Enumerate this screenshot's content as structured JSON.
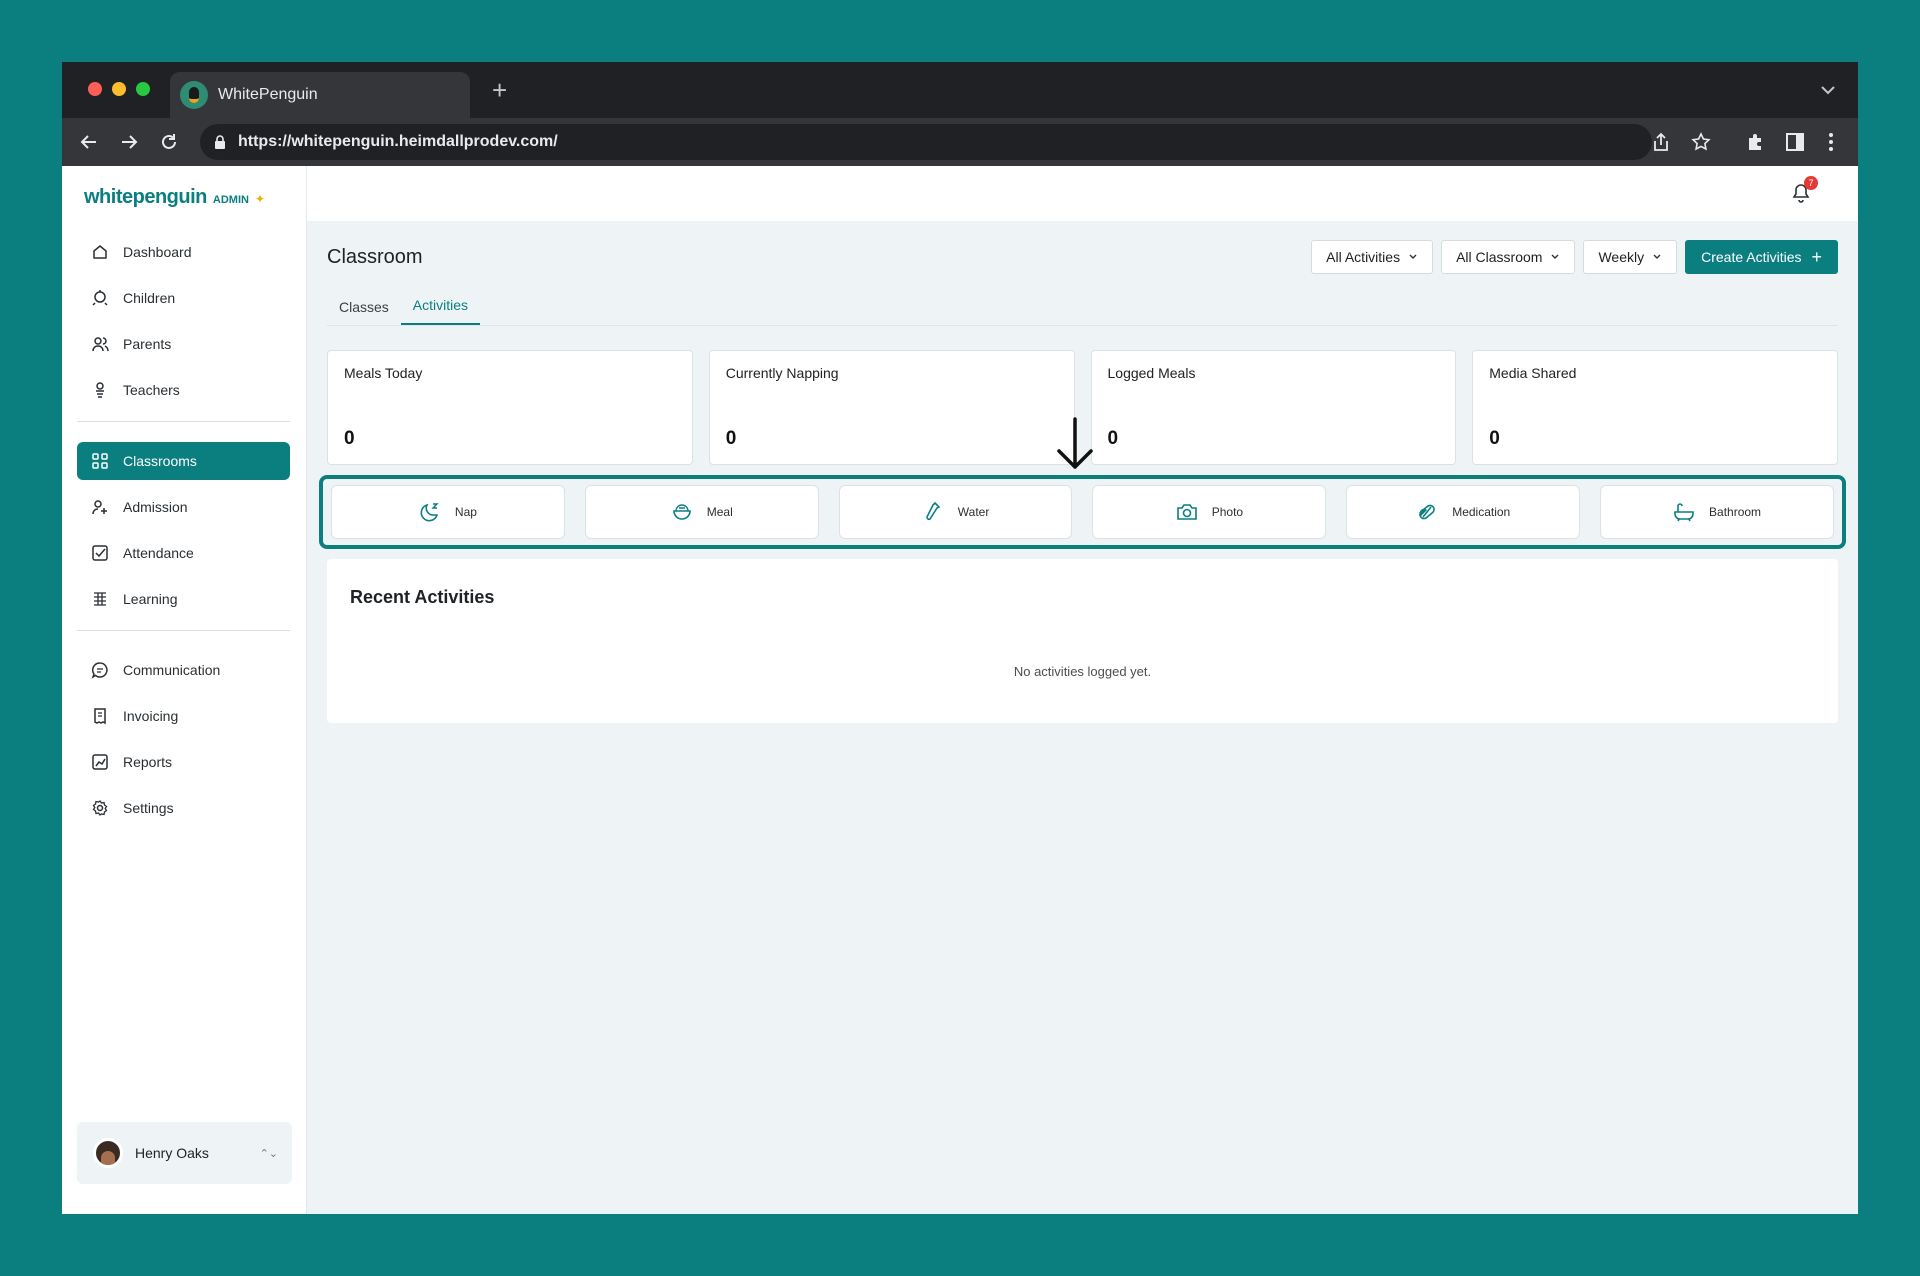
{
  "browser": {
    "tab_title": "WhitePenguin",
    "new_tab": "+",
    "url": "https://whitepenguin.heimdallprodev.com/"
  },
  "brand": {
    "logo": "whitepenguin",
    "role": "ADMIN",
    "badge": "✦"
  },
  "sidebar": {
    "items": [
      {
        "label": "Dashboard",
        "icon": "home-icon"
      },
      {
        "label": "Children",
        "icon": "child-icon"
      },
      {
        "label": "Parents",
        "icon": "parents-icon"
      },
      {
        "label": "Teachers",
        "icon": "teacher-icon"
      }
    ],
    "items2": [
      {
        "label": "Classrooms",
        "icon": "grid-icon",
        "active": true
      },
      {
        "label": "Admission",
        "icon": "admission-icon"
      },
      {
        "label": "Attendance",
        "icon": "check-icon"
      },
      {
        "label": "Learning",
        "icon": "learning-icon"
      }
    ],
    "items3": [
      {
        "label": "Communication",
        "icon": "chat-icon"
      },
      {
        "label": "Invoicing",
        "icon": "invoice-icon"
      },
      {
        "label": "Reports",
        "icon": "reports-icon"
      },
      {
        "label": "Settings",
        "icon": "gear-icon"
      }
    ]
  },
  "user": {
    "name": "Henry Oaks",
    "caret": "⌃⌄"
  },
  "notifications": {
    "count": "7"
  },
  "page": {
    "title": "Classroom",
    "filters": {
      "activities": "All Activities",
      "classroom": "All Classroom",
      "period": "Weekly"
    },
    "create_button": "Create Activities",
    "create_plus": "+",
    "tabs": [
      {
        "label": "Classes",
        "active": false
      },
      {
        "label": "Activities",
        "active": true
      }
    ]
  },
  "stats": [
    {
      "label": "Meals Today",
      "value": "0"
    },
    {
      "label": "Currently Napping",
      "value": "0"
    },
    {
      "label": "Logged Meals",
      "value": "0"
    },
    {
      "label": "Media Shared",
      "value": "0"
    }
  ],
  "quick_actions": [
    {
      "label": "Nap",
      "icon": "moon-icon"
    },
    {
      "label": "Meal",
      "icon": "bowl-icon"
    },
    {
      "label": "Water",
      "icon": "bottle-icon"
    },
    {
      "label": "Photo",
      "icon": "camera-icon"
    },
    {
      "label": "Medication",
      "icon": "pill-icon"
    },
    {
      "label": "Bathroom",
      "icon": "bathtub-icon"
    }
  ],
  "recent": {
    "title": "Recent Activities",
    "empty": "No activities logged yet."
  },
  "colors": {
    "accent": "#0b7f80",
    "background": "#0b7f80",
    "main_bg": "#eef4f6",
    "badge": "#e53935"
  }
}
